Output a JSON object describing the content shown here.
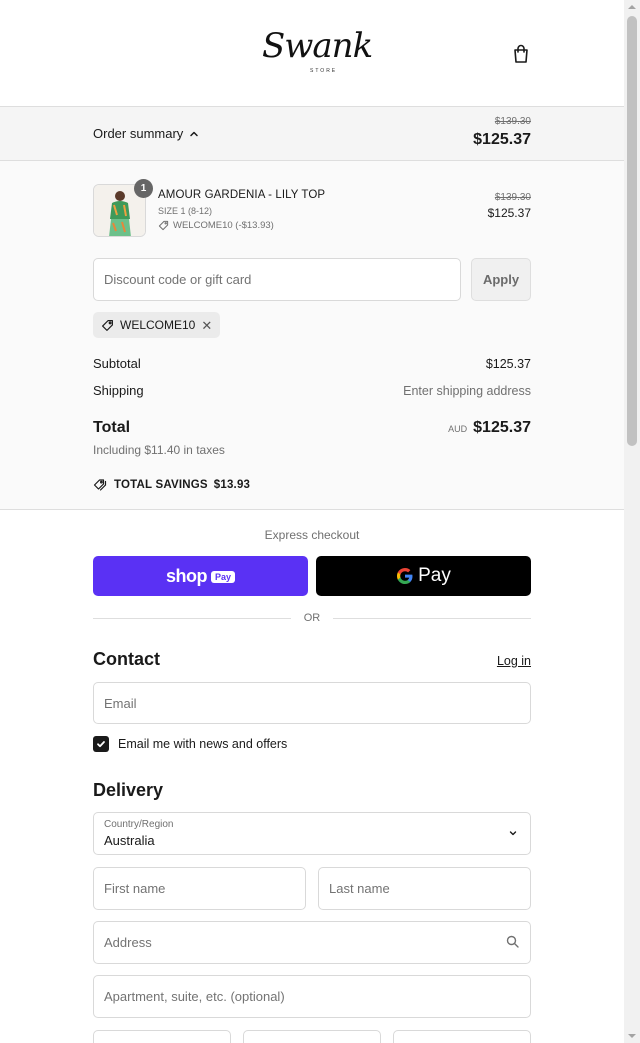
{
  "header": {
    "logo_script": "Swank",
    "logo_sub": "STORE",
    "bag_icon": "shopping-bag-icon"
  },
  "summary_bar": {
    "toggle_label": "Order summary",
    "old_total": "$139.30",
    "total": "$125.37"
  },
  "cart": {
    "quantity": "1",
    "product_name": "AMOUR GARDENIA - LILY TOP",
    "size": "SIZE 1 (8-12)",
    "discount": "WELCOME10 (-$13.93)",
    "old_price": "$139.30",
    "price": "$125.37"
  },
  "discount": {
    "placeholder": "Discount code or gift card",
    "apply_label": "Apply",
    "applied_code": "WELCOME10"
  },
  "totals": {
    "subtotal_label": "Subtotal",
    "subtotal_value": "$125.37",
    "shipping_label": "Shipping",
    "shipping_value": "Enter shipping address",
    "total_label": "Total",
    "currency": "AUD",
    "total_value": "$125.37",
    "taxes_note": "Including $11.40 in taxes",
    "savings_label": "TOTAL SAVINGS",
    "savings_value": "$13.93"
  },
  "express": {
    "label": "Express checkout",
    "shop_word": "shop",
    "shop_pay": "Pay",
    "gpay_word": "Pay",
    "or_label": "OR"
  },
  "contact": {
    "title": "Contact",
    "login_label": "Log in",
    "email_placeholder": "Email",
    "newsletter_label": "Email me with news and offers",
    "newsletter_checked": true
  },
  "delivery": {
    "title": "Delivery",
    "country_label": "Country/Region",
    "country_value": "Australia",
    "first_name_placeholder": "First name",
    "last_name_placeholder": "Last name",
    "address_placeholder": "Address",
    "apartment_placeholder": "Apartment, suite, etc. (optional)"
  },
  "colors": {
    "shop_pay": "#5a31f4",
    "google_pay": "#000000",
    "summary_bg": "#f5f5f5"
  }
}
